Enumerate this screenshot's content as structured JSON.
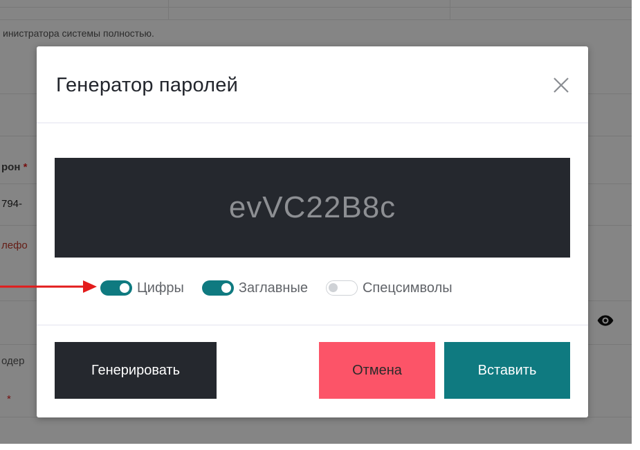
{
  "background": {
    "admin_text": "инистратора системы полностью.",
    "phone_label": "рон",
    "phone_required": "*",
    "phone_value": "794-",
    "phone_error": "лефо",
    "content_label": "одер",
    "required_star": "*"
  },
  "modal": {
    "title": "Генератор паролей",
    "password": "evVC22B8c",
    "options": [
      {
        "label": "Цифры",
        "checked": true
      },
      {
        "label": "Заглавные",
        "checked": true
      },
      {
        "label": "Спецсимволы",
        "checked": false
      }
    ],
    "buttons": {
      "generate": "Генерировать",
      "cancel": "Отмена",
      "insert": "Вставить"
    }
  },
  "colors": {
    "accent": "#0f7a80",
    "danger": "#fc5468",
    "dark": "#25282e",
    "annotation_arrow": "#e31b1b"
  },
  "icons": {
    "close": "close-icon",
    "eye": "eye-icon",
    "arrow": "red-arrow-icon"
  }
}
